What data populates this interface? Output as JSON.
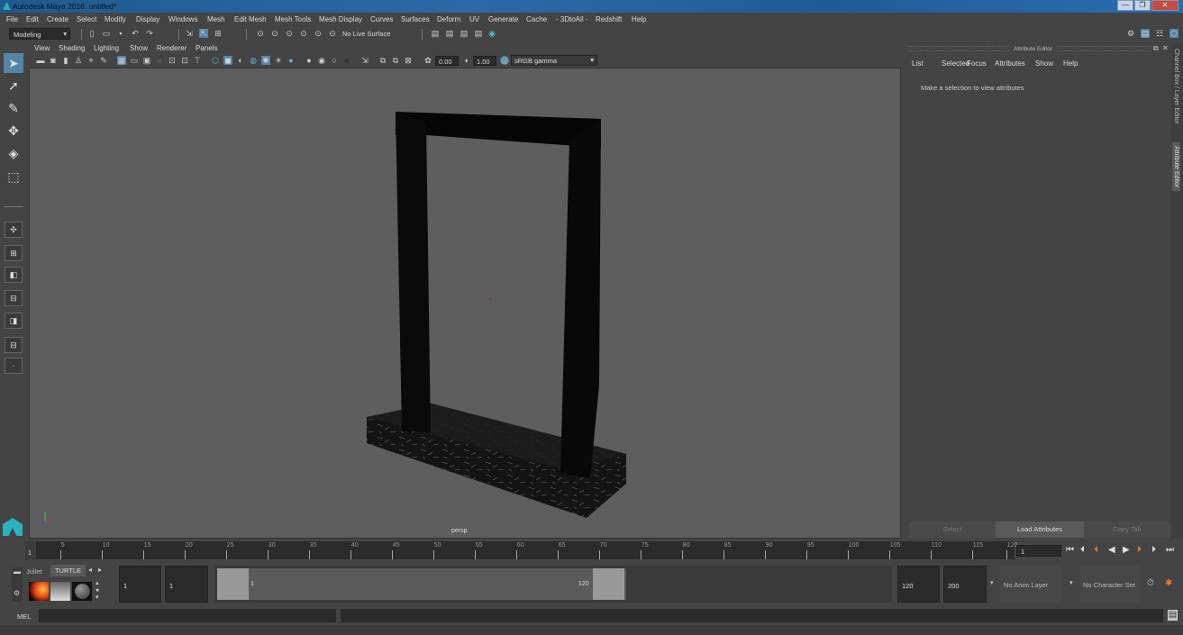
{
  "window": {
    "title": "Autodesk Maya 2016: untitled*",
    "minimize": "—",
    "restore": "❐",
    "close": "✕"
  },
  "menubar": [
    "File",
    "Edit",
    "Create",
    "Select",
    "Modify",
    "Display",
    "Windows",
    "Mesh",
    "Edit Mesh",
    "Mesh Tools",
    "Mesh Display",
    "Curves",
    "Surfaces",
    "Deform",
    "UV",
    "Generate",
    "Cache",
    "- 3DtoAll -",
    "Redshift",
    "Help"
  ],
  "toolbar": {
    "mode": "Modeling",
    "live_surface": "No Live Surface"
  },
  "viewport": {
    "menus": [
      "View",
      "Shading",
      "Lighting",
      "Show",
      "Renderer",
      "Panels"
    ],
    "exposure": "0.00",
    "gamma": "1.00",
    "color_space": "sRGB gamma",
    "camera_label": "persp"
  },
  "attribute_editor": {
    "title": "Attribute Editor",
    "menus": [
      "List",
      "Selected",
      "Focus",
      "Attributes",
      "Show",
      "Help"
    ],
    "message": "Make a selection to view attributes",
    "buttons": {
      "select": "Select",
      "load": "Load Attributes",
      "copy": "Copy Tab"
    }
  },
  "side_tabs": {
    "channel_box": "Channel Box / Layer Editor",
    "attribute_editor": "Attribute Editor"
  },
  "timeline": {
    "ticks": [
      "5",
      "10",
      "15",
      "20",
      "25",
      "30",
      "35",
      "40",
      "45",
      "50",
      "55",
      "60",
      "65",
      "70",
      "75",
      "80",
      "85",
      "90",
      "95",
      "100",
      "105",
      "110",
      "115",
      "120"
    ],
    "current_frame_marker": "1",
    "current_frame": "1"
  },
  "range": {
    "shelf_tabs": [
      "Jullet",
      "TURTLE"
    ],
    "start": "1",
    "inner_start": "1",
    "slider_start": "1",
    "slider_end": "120",
    "inner_end": "120",
    "end": "200",
    "anim_layer": "No Anim Layer",
    "character_set": "No Character Set"
  },
  "command": {
    "label": "MEL"
  },
  "colors": {
    "accent": "#5285a6",
    "viewport_bg": "#5e5e5e",
    "panel_bg": "#444444"
  }
}
